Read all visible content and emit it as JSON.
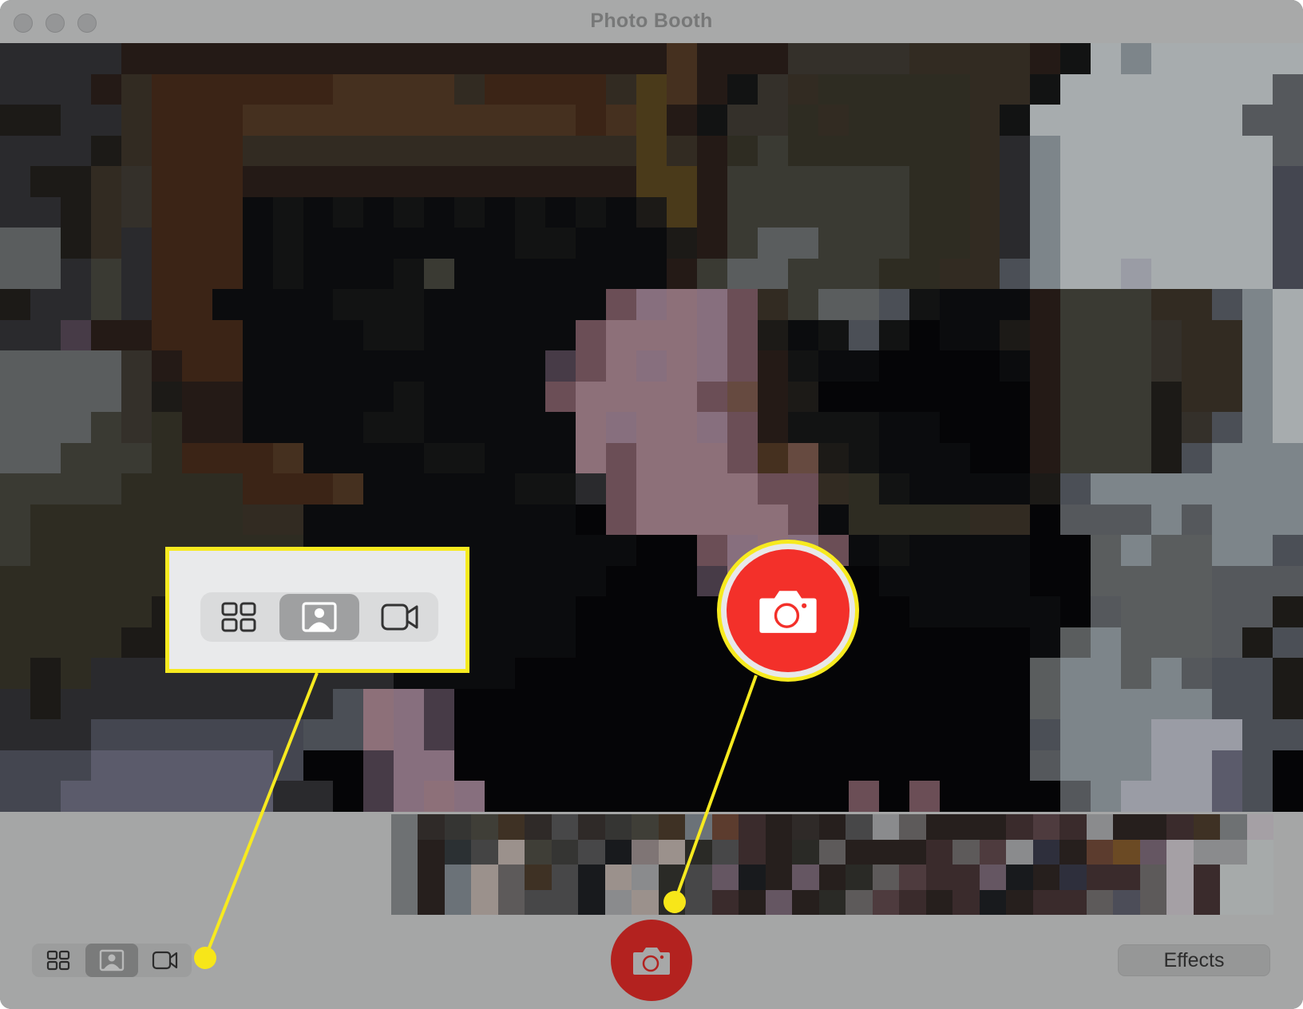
{
  "window": {
    "title": "Photo Booth",
    "controls": [
      "close",
      "minimize",
      "zoom"
    ]
  },
  "preview": {
    "description": "pixelated live camera preview",
    "mosaic_palette": {
      "a": "#2a2a2d",
      "b": "#241a16",
      "c": "#3b2416",
      "d": "#45301f",
      "e": "#0b0c0e",
      "f": "#121313",
      "g": "#3a3a33",
      "h": "#5a5d5e",
      "i": "#8d7079",
      "j": "#6b4e56",
      "k": "#a7acae",
      "l": "#7d858a",
      "m": "#4b4f56",
      "n": "#34302a",
      "o": "#1c1a17",
      "p": "#55585c",
      "q": "#9a9ca5",
      "r": "#444650",
      "s": "#5b5b6b",
      "t": "#322b22",
      "u": "#4a3a1a",
      "v": "#2e2c22",
      "w": "#050507",
      "x": "#473b47",
      "y": "#876f7e",
      "z": "#664a40"
    },
    "mosaic_rows": [
      "aaaabbbbbbbbbbbbbbbbbbdbbbnnnnttttbfklkkkkk",
      "aaabtccccccddddtcccctudbfntvvvvvttfkkkkkkkp",
      "ooaatcccdddddddddddcdubfnnvtvvvvtfkkkkkkkp",
      "aaaotccctttttttttttttutbvgvvvvvvtalkkkkkkkp",
      "aootncccbbbbbbbbbbbbbuubggggggvvtalkkkkkkkr",
      "aaotncccefefefefefefeoubggggggvvtalkkkkkkkr",
      "hhotacccefeeeeeeeffeeeobghhgggvvtalkkkkkkkr",
      "hhagacccefeeefgeeeeeeebghhgggvvttmlkkqkkkkr",
      "oaagacceeeefffeeeeeejyiyjtghhmfeeebgggttmlkqkkkk",
      "aaxbbccceeeeffeeeeejiiiyjoefmfweeobgggnttlkkqqkr",
      "hhhhnbcceeeeeeeeeexjiyiyjbfeewwwwebgggnttlkqqqkr",
      "hhhhnobbeeeeefeeeejiiiijzbowwwwwwwbgggottlkqqqqk",
      "hhhgnvbbeeeeffeeeeeiyiiyjbfffeewwwbgggonmlkqqqqq",
      "hhgggvcccdeeeeffeeeijiiijdzofeeewwbgggomllllllmp",
      "ggggvvvvcccdeeeeeffajiiiijjtvfeeeeomlllllllmmp",
      "gvvvvvvvtteeeeeeeeewjiiiiijevvvvttwppplplllmmp",
      "gvvvvvvvvveeeeeeeeeeewwjyiyjefeeeewwhlhhllmmlp",
      "vvvvvvvvtoeeeeeeeeeewwwxiyxwweeeeewwhhhhpppmmlp",
      "vvvvvoonweeeeeeeeeewwwwwwwwewweeeeewphhhppommlp",
      "vvvvoonaaaaaaaeeeeewwwwwwwwwwwwwwwehlhhhpommllp",
      "vovaaaaaaaaaaeeeewwwwwwwwwwwwwwwwwhllhlpmmolllp",
      "aoaaaaaaaaamiyxwwwwwwwwwwwwwwwwwwwhlllllmmollq",
      "aaarrrrrrrmmiyxwwwwwwwwwwwwwwwwwwwmlllqqqmmoolq",
      "rrrssssssrwwxyywwwwwwwwwwwwwwwwwwwplllqqsmwwolq",
      "rrsssssssaawxyiywwwwwwwwwwwwjwjwwwwplqqqsmwwolq"
    ]
  },
  "thumbnail_strip": {
    "palette": {
      "a": "#2f2a28",
      "b": "#353533",
      "c": "#3f3e37",
      "d": "#3e3124",
      "e": "#474748",
      "f": "#6e7173",
      "g": "#7f7575",
      "h": "#261f1d",
      "i": "#2b3033",
      "j": "#2a2a26",
      "k": "#181a1d",
      "l": "#5d5a5a",
      "m": "#9b918c",
      "n": "#6b7278",
      "o": "#a6aaaa",
      "p": "#655662",
      "q": "#3a2b2c",
      "r": "#4e3b3e",
      "s": "#8a8b8d",
      "t": "#2e2f3c",
      "u": "#5c3c2e",
      "v": "#6b4a24",
      "w": "#a5a0a5",
      "x": "#4c4d58"
    },
    "rows": [
      "fabcdaeabcdnuqhaheslhhhqrqshhqdfw",
      "fhi mcbekgmjeqhjlhhhqlrsthuvpwsso",
      "fhnmldekmsjepkhphjlrqqpkhtqqlwqoo",
      "fhnmleeksmjeqhphjlrqhqkhqqlxlwqoo"
    ]
  },
  "toolbar": {
    "modes": [
      {
        "name": "four-up",
        "icon": "grid-icon",
        "selected": false
      },
      {
        "name": "single-photo",
        "icon": "portrait-icon",
        "selected": true
      },
      {
        "name": "video",
        "icon": "video-camera-icon",
        "selected": false
      }
    ],
    "shutter_icon": "camera-icon",
    "effects_label": "Effects"
  },
  "annotations": {
    "highlight_color": "#f7ea1f",
    "callouts": [
      {
        "target": "mode-selector",
        "style": "magnified-box"
      },
      {
        "target": "shutter-button",
        "style": "magnified-circle"
      }
    ]
  },
  "colors": {
    "shutter_red": "#b3221f",
    "shutter_red_magnified": "#f3302a",
    "window_gray": "#a5a6a6",
    "title_text": "#777878"
  }
}
